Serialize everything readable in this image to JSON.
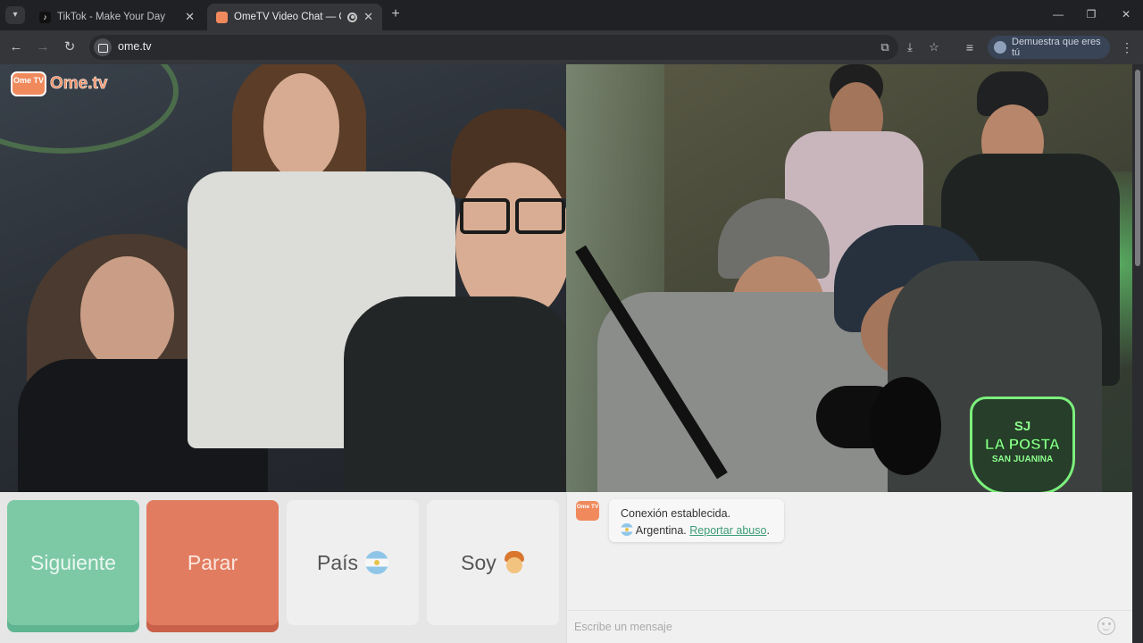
{
  "browser": {
    "tabs": [
      {
        "title": "TikTok - Make Your Day",
        "favicon": "tiktok-icon",
        "active": false
      },
      {
        "title": "OmeTV Video Chat — Ome",
        "favicon": "ometv-icon",
        "active": true
      }
    ],
    "new_tab_icon": "+",
    "window_controls": {
      "minimize": "—",
      "maximize": "❐",
      "close": "✕"
    },
    "address": "ome.tv",
    "profile_label": "Demuestra que eres tú"
  },
  "video": {
    "logo_badge": "Ome TV",
    "logo_text": "Ome.tv",
    "overlay_logo": {
      "line1": "SJ",
      "line2": "LA POSTA",
      "line3": "SAN JUANINA"
    }
  },
  "controls": {
    "next_label": "Siguiente",
    "stop_label": "Parar",
    "country_label": "País",
    "gender_label": "Soy"
  },
  "chat": {
    "logo_badge": "Ome TV",
    "status_line": "Conexión establecida.",
    "country_name": "Argentina.",
    "report_link": "Reportar abuso",
    "report_suffix": ".",
    "input_placeholder": "Escribe un mensaje"
  },
  "colors": {
    "next_button": "#7dc9a6",
    "stop_button": "#e27c60",
    "brand_orange": "#f08a5d",
    "link_green": "#3d9c77"
  }
}
